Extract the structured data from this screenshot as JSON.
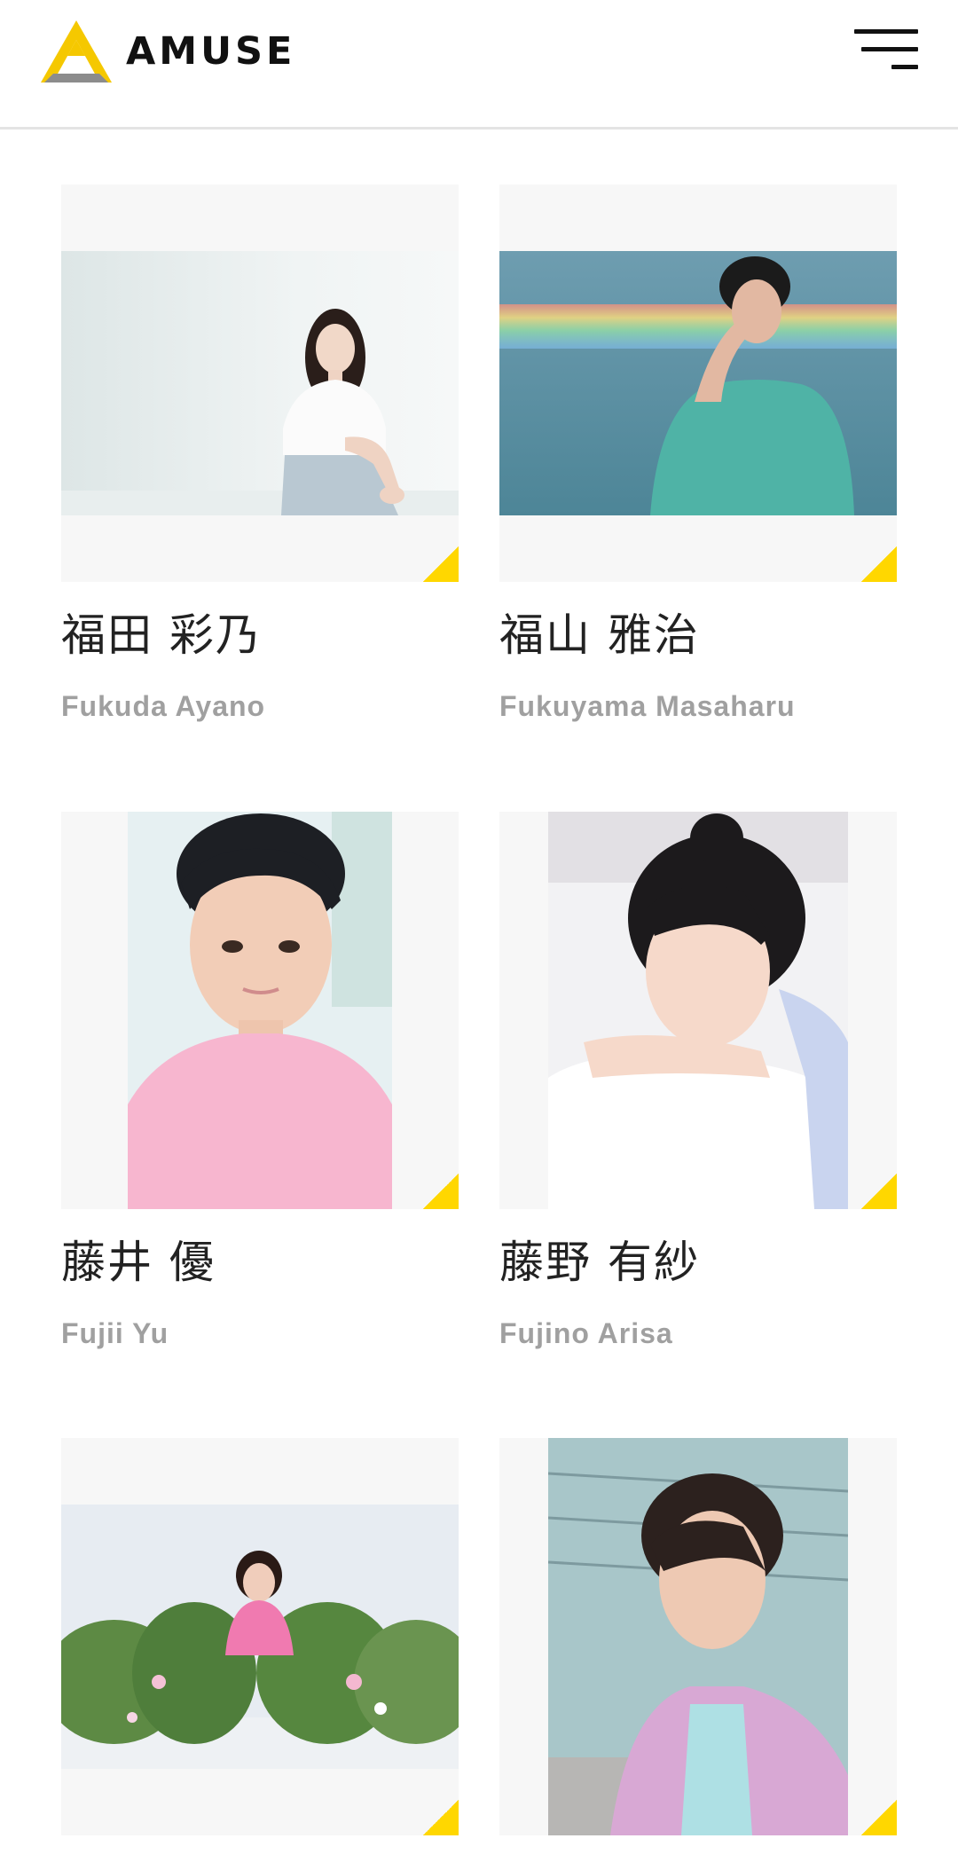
{
  "header": {
    "logo_text": "AMUSE",
    "brand_colors": {
      "yellow": "#F5C800",
      "gray": "#8C8C8C",
      "text": "#111111"
    },
    "menu_icon": "hamburger-menu-icon"
  },
  "talents": [
    {
      "name_jp": "福田 彩乃",
      "name_en": "Fukuda Ayano",
      "photo": "woman in white top sitting against white wall"
    },
    {
      "name_jp": "福山 雅治",
      "name_en": "Fukuyama Masaharu",
      "photo": "man in teal shirt with rainbow light streak"
    },
    {
      "name_jp": "藤井 優",
      "name_en": "Fujii Yu",
      "photo": "boy in pink t-shirt"
    },
    {
      "name_jp": "藤野 有紗",
      "name_en": "Fujino Arisa",
      "photo": "girl with ponytail resting chin on hands"
    },
    {
      "name_jp": "",
      "name_en": "",
      "photo": "woman in pink among green plants and flowers"
    },
    {
      "name_jp": "",
      "name_en": "",
      "photo": "young man in pastel patterned shirt"
    }
  ],
  "accent_color": "#FFD700"
}
